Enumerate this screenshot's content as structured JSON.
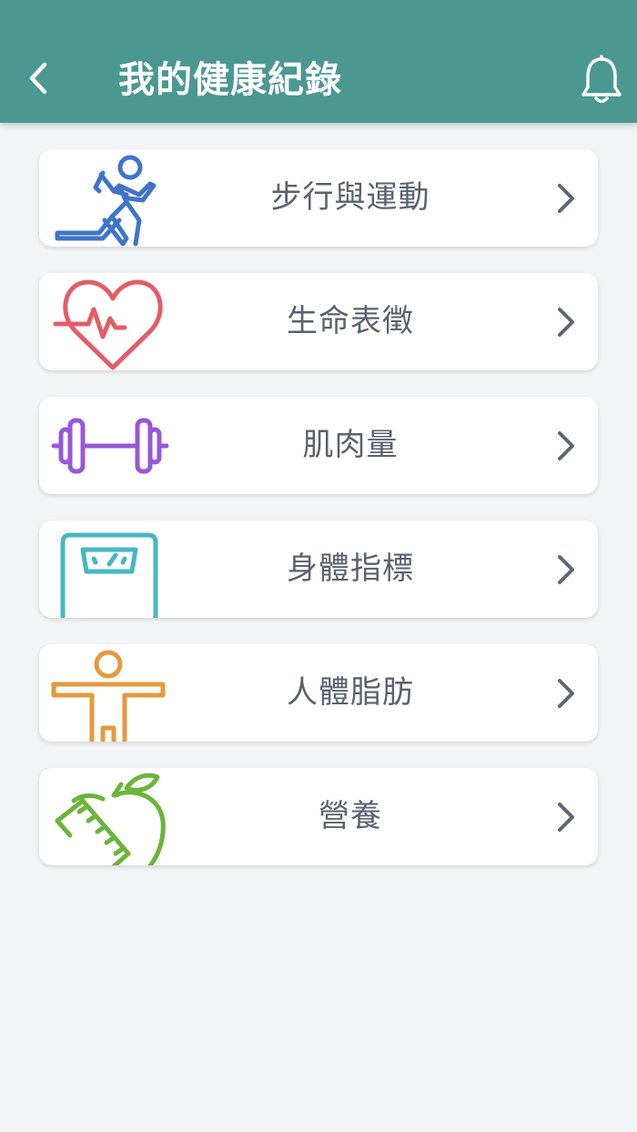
{
  "header": {
    "title": "我的健康紀錄",
    "back_icon": "chevron-left-icon",
    "notification_icon": "bell-icon",
    "bg_color": "#4a9891"
  },
  "categories": [
    {
      "label": "步行與運動",
      "icon": "running-person-icon",
      "color": "#3f74c9"
    },
    {
      "label": "生命表徵",
      "icon": "heartbeat-icon",
      "color": "#e35d66"
    },
    {
      "label": "肌肉量",
      "icon": "dumbbell-icon",
      "color": "#9857d9"
    },
    {
      "label": "身體指標",
      "icon": "scale-icon",
      "color": "#45b8c3"
    },
    {
      "label": "人體脂肪",
      "icon": "body-figure-icon",
      "color": "#e59a3c"
    },
    {
      "label": "營養",
      "icon": "apple-measuring-tape-icon",
      "color": "#6cb43a"
    }
  ],
  "chevron_color": "#5d6576"
}
